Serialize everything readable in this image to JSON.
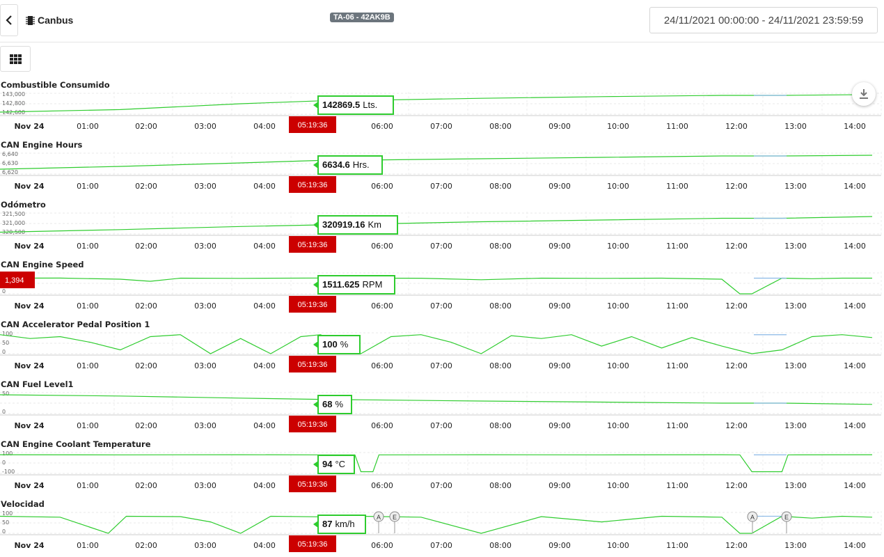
{
  "header": {
    "title": "Canbus",
    "plate": "TA-06 - 42AK9B",
    "date_range": "24/11/2021 00:00:00 - 24/11/2021 23:59:59"
  },
  "icons": {
    "back": "chevron-left-icon",
    "app": "chip-icon",
    "menu": "grid-icon",
    "download": "download-icon"
  },
  "colors": {
    "line": "#2ecc2e",
    "gap_line": "#8ab8e6",
    "cursor_label": "#cc0000",
    "tooltip_border": "#2ecc2e"
  },
  "cursor": {
    "time_label": "05:19:36"
  },
  "x_ticks": [
    "Nov 24",
    "01:00",
    "02:00",
    "03:00",
    "04:00",
    "06:00",
    "07:00",
    "08:00",
    "09:00",
    "10:00",
    "11:00",
    "12:00",
    "13:00",
    "14:00"
  ],
  "charts": [
    {
      "title": "Combustible Consumido",
      "y_ticks": [
        "143,000",
        "142,800",
        "142,600"
      ],
      "value": "142869.5",
      "unit": "Lts."
    },
    {
      "title": "CAN Engine Hours",
      "y_ticks": [
        "6,640",
        "6,630",
        "6,620"
      ],
      "value": "6634.6",
      "unit": "Hrs."
    },
    {
      "title": "Odómetro",
      "y_ticks": [
        "321,500",
        "321,000",
        "320,500"
      ],
      "value": "320919.16",
      "unit": "Km"
    },
    {
      "title": "CAN Engine Speed",
      "y_ticks": [
        "0"
      ],
      "value": "1511.625",
      "unit": "RPM",
      "y_label_box": "1,394"
    },
    {
      "title": "CAN Accelerator Pedal Position 1",
      "y_ticks": [
        "100",
        "50",
        "0"
      ],
      "value": "100",
      "unit": "%"
    },
    {
      "title": "CAN Fuel Level1",
      "y_ticks": [
        "50",
        "0"
      ],
      "value": "68",
      "unit": "%"
    },
    {
      "title": "CAN Engine Coolant Temperature",
      "y_ticks": [
        "100",
        "0",
        "-100"
      ],
      "value": "94",
      "unit": "°C"
    },
    {
      "title": "Velocidad",
      "y_ticks": [
        "100",
        "50",
        "0"
      ],
      "value": "87",
      "unit": "km/h",
      "markers": [
        "A",
        "E",
        "A",
        "E"
      ]
    }
  ],
  "chart_data": [
    {
      "type": "line",
      "title": "Combustible Consumido",
      "x_range": [
        "00:00",
        "14:30"
      ],
      "ylim": [
        142550,
        143050
      ],
      "x_hours": [
        0,
        2,
        4,
        5.33,
        6,
        8,
        10,
        12,
        13,
        14.5
      ],
      "y": [
        142600,
        142660,
        142800,
        142869.5,
        142880,
        142930,
        142970,
        143000,
        143000,
        143020
      ]
    },
    {
      "type": "line",
      "title": "CAN Engine Hours",
      "x_range": [
        "00:00",
        "14:30"
      ],
      "ylim": [
        6615,
        6645
      ],
      "x_hours": [
        0,
        2,
        4,
        5.33,
        6,
        8,
        10,
        12,
        13,
        14.5
      ],
      "y": [
        6622,
        6626,
        6631,
        6634.6,
        6635,
        6637,
        6639,
        6641,
        6641,
        6642
      ]
    },
    {
      "type": "line",
      "title": "Odómetro",
      "x_range": [
        "00:00",
        "14:30"
      ],
      "ylim": [
        320400,
        321600
      ],
      "x_hours": [
        0,
        2,
        4,
        5.33,
        6,
        8,
        10,
        12,
        13,
        14.5
      ],
      "y": [
        320500,
        320650,
        320830,
        320919.16,
        320960,
        321100,
        321200,
        321300,
        321300,
        321400
      ]
    },
    {
      "type": "line",
      "title": "CAN Engine Speed",
      "x_range": [
        "00:00",
        "14:30"
      ],
      "ylim": [
        0,
        2000
      ],
      "x_hours": [
        0,
        1,
        2,
        2.5,
        3,
        4,
        5.33,
        6,
        7,
        8,
        9,
        10,
        11,
        12,
        12.3,
        12.5,
        13,
        13.5,
        14,
        14.5
      ],
      "y": [
        1500,
        1510,
        1400,
        1200,
        1500,
        1480,
        1511.625,
        1500,
        1490,
        1350,
        1500,
        1480,
        1500,
        1400,
        0,
        0,
        1500,
        1450,
        1500,
        1500
      ]
    },
    {
      "type": "line",
      "title": "CAN Accelerator Pedal Position 1",
      "x_range": [
        "00:00",
        "14:30"
      ],
      "ylim": [
        0,
        110
      ],
      "x_hours": [
        0,
        0.5,
        1,
        1.5,
        2,
        2.5,
        3,
        3.5,
        4,
        4.5,
        5,
        5.33,
        6,
        6.5,
        7,
        7.5,
        8,
        8.5,
        9,
        9.5,
        10,
        10.5,
        11,
        11.5,
        12,
        12.5,
        13,
        13.5,
        14,
        14.5
      ],
      "y": [
        100,
        80,
        90,
        60,
        20,
        90,
        100,
        0,
        80,
        0,
        90,
        100,
        0,
        90,
        100,
        60,
        0,
        95,
        80,
        100,
        40,
        90,
        30,
        85,
        40,
        0,
        20,
        90,
        100,
        85
      ]
    },
    {
      "type": "line",
      "title": "CAN Fuel Level1",
      "x_range": [
        "00:00",
        "14:30"
      ],
      "ylim": [
        0,
        100
      ],
      "x_hours": [
        0,
        2,
        4,
        5.33,
        6,
        8,
        10,
        12,
        13,
        14.5
      ],
      "y": [
        90,
        84,
        74,
        68,
        66,
        60,
        55,
        50,
        50,
        44
      ]
    },
    {
      "type": "line",
      "title": "CAN Engine Coolant Temperature",
      "x_range": [
        "00:00",
        "14:30"
      ],
      "ylim": [
        -120,
        120
      ],
      "x_hours": [
        0,
        2,
        4,
        5.33,
        5.9,
        6.0,
        6.2,
        6.3,
        8,
        10,
        12,
        12.3,
        12.5,
        13,
        13.1,
        14.5
      ],
      "y": [
        95,
        94,
        95,
        94,
        94,
        -100,
        -100,
        94,
        95,
        94,
        95,
        94,
        -100,
        -100,
        94,
        95
      ]
    },
    {
      "type": "line",
      "title": "Velocidad",
      "x_range": [
        "00:00",
        "14:30"
      ],
      "ylim": [
        0,
        110
      ],
      "x_hours": [
        0,
        1,
        1.8,
        2.1,
        3,
        3.5,
        4,
        4.5,
        5.33,
        6,
        7,
        8,
        9,
        10,
        11,
        12,
        12.3,
        12.5,
        13,
        13.5,
        14,
        14.5
      ],
      "y": [
        90,
        85,
        0,
        90,
        88,
        60,
        0,
        90,
        87,
        90,
        85,
        0,
        88,
        60,
        90,
        85,
        0,
        0,
        90,
        80,
        90,
        85
      ]
    }
  ]
}
